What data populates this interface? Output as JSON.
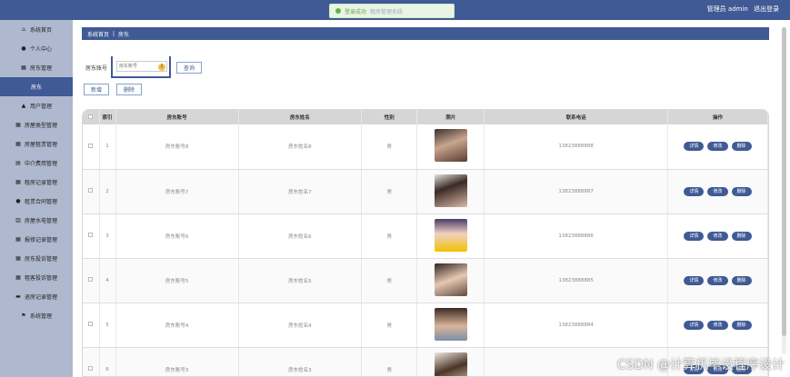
{
  "topbar": {
    "user_label": "管理员 admin",
    "logout_label": "退出登录"
  },
  "toast": {
    "text": "登录成功",
    "extra": "租房管理系统"
  },
  "sidebar": {
    "items": [
      {
        "label": "系统首页",
        "icon": "home-icon",
        "glyph": "⌂"
      },
      {
        "label": "个人中心",
        "icon": "person-icon",
        "glyph": "●"
      },
      {
        "label": "房东管理",
        "icon": "list-icon",
        "glyph": "▦"
      },
      {
        "label": "房东",
        "icon": "",
        "glyph": "",
        "sub": true
      },
      {
        "label": "用户管理",
        "icon": "user-group-icon",
        "glyph": "▲"
      },
      {
        "label": "房屋类型管理",
        "icon": "grid-icon",
        "glyph": "▦"
      },
      {
        "label": "房屋租赁管理",
        "icon": "grid-icon",
        "glyph": "▦"
      },
      {
        "label": "中介费用管理",
        "icon": "database-icon",
        "glyph": "▤"
      },
      {
        "label": "租房记录管理",
        "icon": "grid-icon",
        "glyph": "▦"
      },
      {
        "label": "租赁合同管理",
        "icon": "person-icon",
        "glyph": "●"
      },
      {
        "label": "房屋水电管理",
        "icon": "chart-icon",
        "glyph": "▥"
      },
      {
        "label": "报修记录管理",
        "icon": "grid-icon",
        "glyph": "▦"
      },
      {
        "label": "房东投诉管理",
        "icon": "grid-icon",
        "glyph": "▦"
      },
      {
        "label": "租客投诉管理",
        "icon": "grid-icon",
        "glyph": "▦"
      },
      {
        "label": "退房记录管理",
        "icon": "chat-icon",
        "glyph": "▬"
      },
      {
        "label": "系统管理",
        "icon": "flag-icon",
        "glyph": "⚑"
      }
    ]
  },
  "breadcrumb": {
    "home": "系统首页",
    "current": "房东"
  },
  "search": {
    "label": "房东账号",
    "placeholder": "房东账号",
    "button": "查询"
  },
  "ops": {
    "add": "新增",
    "delete": "删除"
  },
  "table": {
    "headers": [
      "",
      "索引",
      "房东账号",
      "房东姓名",
      "性别",
      "照片",
      "联系电话",
      "操作"
    ],
    "actions": [
      "详情",
      "修改",
      "删除"
    ],
    "rows": [
      {
        "index": "1",
        "account": "房东账号8",
        "name": "房东姓名8",
        "gender": "男",
        "phone": "13823888888",
        "photo": "ph-a"
      },
      {
        "index": "2",
        "account": "房东账号7",
        "name": "房东姓名7",
        "gender": "男",
        "phone": "13823888887",
        "photo": "ph-b"
      },
      {
        "index": "3",
        "account": "房东账号6",
        "name": "房东姓名6",
        "gender": "男",
        "phone": "13823888886",
        "photo": "ph-c"
      },
      {
        "index": "4",
        "account": "房东账号5",
        "name": "房东姓名5",
        "gender": "男",
        "phone": "13823888885",
        "photo": "ph-d"
      },
      {
        "index": "5",
        "account": "房东账号4",
        "name": "房东姓名4",
        "gender": "男",
        "phone": "13823888884",
        "photo": "ph-e"
      },
      {
        "index": "6",
        "account": "房东账号3",
        "name": "房东姓名3",
        "gender": "男",
        "phone": "",
        "photo": "ph-f"
      }
    ]
  },
  "watermark": "CSDN @计算机毕设程序设计"
}
